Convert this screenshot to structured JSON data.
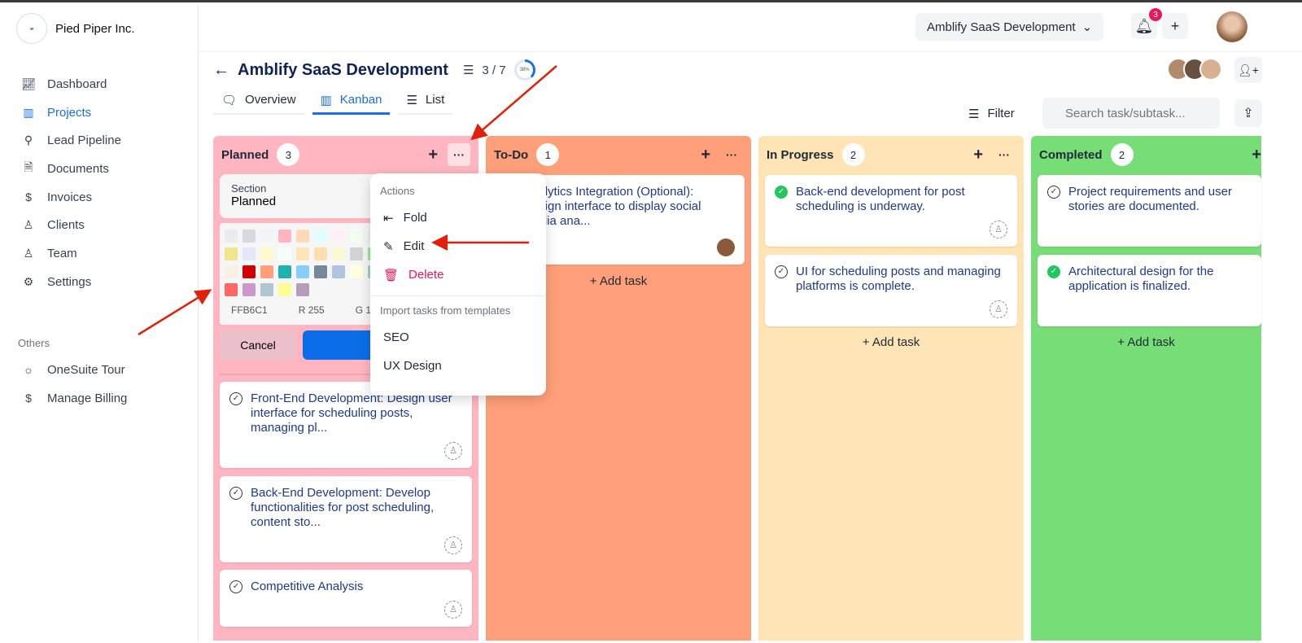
{
  "org": {
    "name": "Pied Piper Inc.",
    "logo_text": "piedpiper"
  },
  "sidebar": {
    "items": [
      {
        "label": "Dashboard",
        "icon": "chart-icon"
      },
      {
        "label": "Projects",
        "icon": "kanban-icon",
        "active": true
      },
      {
        "label": "Lead Pipeline",
        "icon": "search-person-icon"
      },
      {
        "label": "Documents",
        "icon": "document-icon"
      },
      {
        "label": "Invoices",
        "icon": "invoice-icon"
      },
      {
        "label": "Clients",
        "icon": "person-icon"
      },
      {
        "label": "Team",
        "icon": "team-icon"
      },
      {
        "label": "Settings",
        "icon": "gear-icon"
      }
    ],
    "others_label": "Others",
    "others": [
      {
        "label": "OneSuite Tour",
        "icon": "sun-icon"
      },
      {
        "label": "Manage Billing",
        "icon": "dollar-icon"
      }
    ]
  },
  "topbar": {
    "project_selector": "Amblify SaaS Development",
    "notifications": "3"
  },
  "project": {
    "title": "Amblify SaaS Development",
    "task_count": "3 / 7",
    "progress_label": "38%",
    "progress": 38
  },
  "tabs": [
    {
      "label": "Overview"
    },
    {
      "label": "Kanban",
      "active": true
    },
    {
      "label": "List"
    }
  ],
  "toolbar": {
    "filter": "Filter",
    "search_placeholder": "Search task/subtask..."
  },
  "section_editor": {
    "label": "Section",
    "value": "Planned",
    "hex": "FFB6C1",
    "r": "R 255",
    "g": "G 1",
    "cancel": "Cancel",
    "swatches": [
      "#E9EBEF",
      "#D5DAE1",
      "#F3F4F6",
      "#FFB6C1",
      "#FFDAB9",
      "#E0FFFF",
      "#FFF0F5",
      "#F0FFF0",
      "#E6EEF8",
      "#F0E68C",
      "#E6E6FA",
      "#FFFACD",
      "#F5FFFA",
      "#FFE4B5",
      "#FFDEAD",
      "#FAFAD2",
      "#D3D3D3",
      "#90EE90",
      "#FAF0E6",
      "#D10000",
      "#FFA07A",
      "#20B2AA",
      "#87CEFA",
      "#778899",
      "#B0C4DE",
      "#FFFFE0",
      "#A0D0D0",
      "#FF6961",
      "#CC99CC",
      "#AEC6CF",
      "#FDFD96",
      "#B39EB5"
    ]
  },
  "menu": {
    "actions_label": "Actions",
    "fold": "Fold",
    "edit": "Edit",
    "delete": "Delete",
    "import_label": "Import tasks from templates",
    "templates": [
      "SEO",
      "UX Design"
    ]
  },
  "add_task": "Add task",
  "columns": [
    {
      "name": "Planned",
      "count": "3",
      "color": "#FFB6C1",
      "tasks": [
        "Front-End Development: Design user interface for scheduling posts, managing pl...",
        "Back-End Development: Develop functionalities for post scheduling, content sto...",
        "Competitive Analysis"
      ]
    },
    {
      "name": "To-Do",
      "count": "1",
      "color": "#FFA07A",
      "tasks": [
        "Analytics Integration (Optional): Design interface to display social media ana..."
      ]
    },
    {
      "name": "In Progress",
      "count": "2",
      "color": "#FFE4B5",
      "tasks": [
        "Back-end development for post scheduling is underway.",
        "UI for scheduling posts and managing platforms is complete."
      ]
    },
    {
      "name": "Completed",
      "count": "2",
      "color": "#77DD77",
      "tasks": [
        "Project requirements and user stories are documented.",
        "Architectural design for the application is finalized."
      ]
    }
  ]
}
